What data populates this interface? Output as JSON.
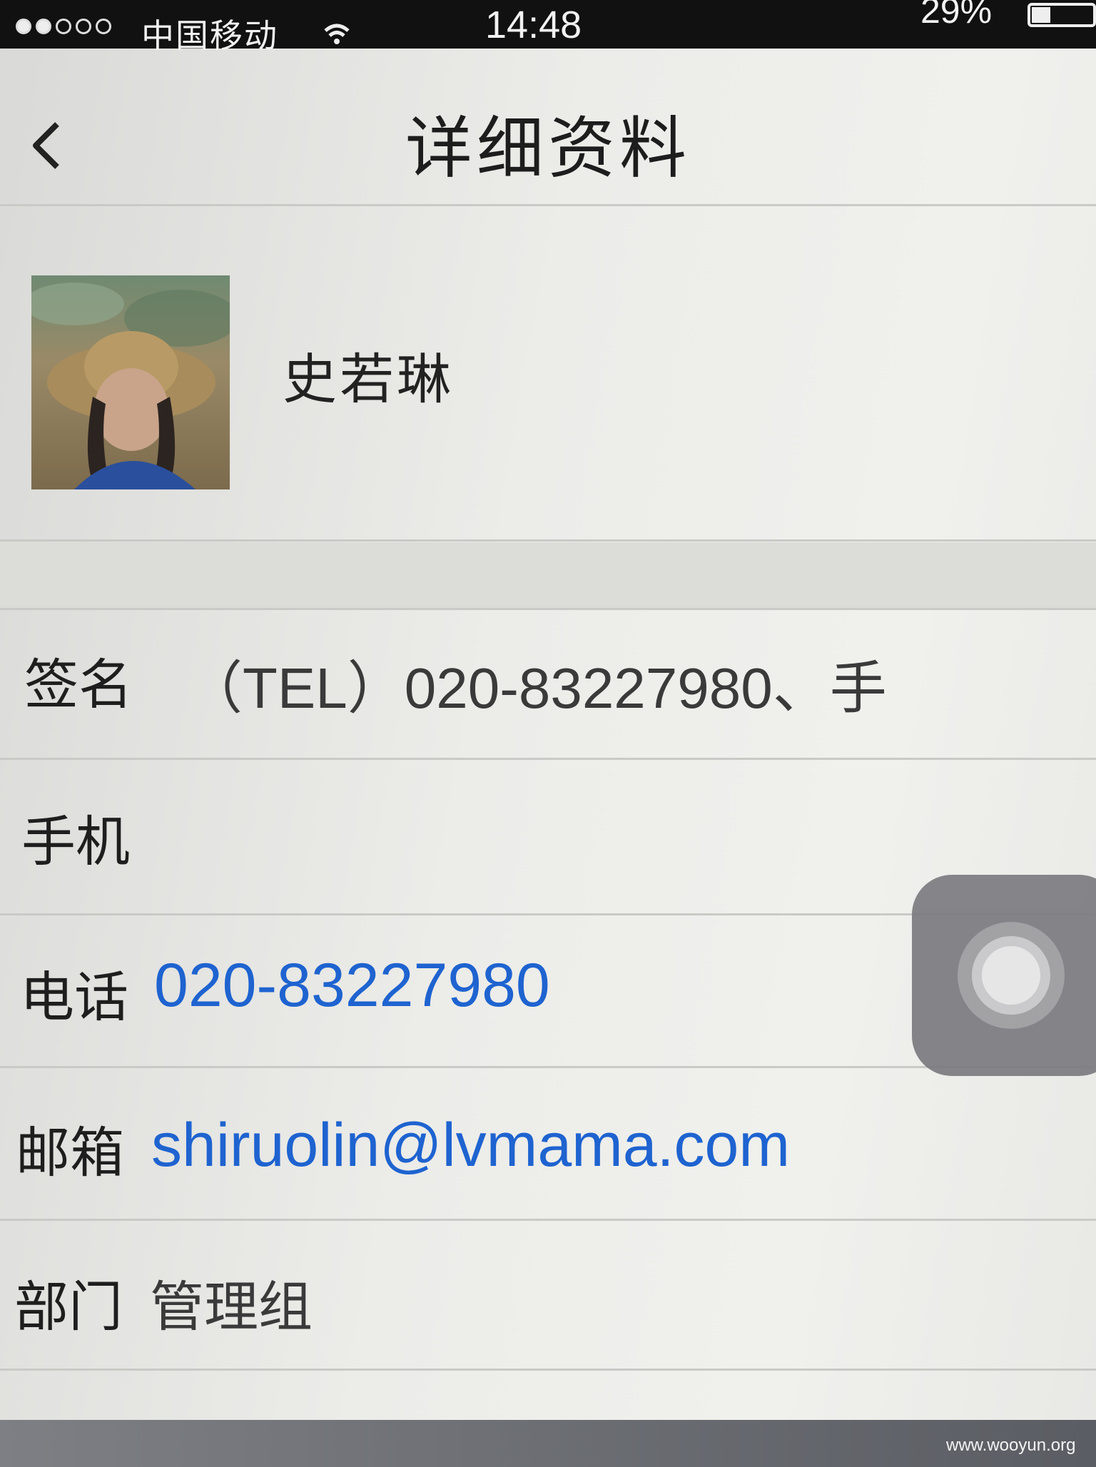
{
  "status_bar": {
    "carrier": "中国移动",
    "time": "14:48",
    "battery_percent": "29%",
    "signal_strength_bars": 2,
    "signal_total_bars": 5
  },
  "nav": {
    "title": "详细资料",
    "back_icon": "chevron-left-icon"
  },
  "profile": {
    "name": "史若琳",
    "avatar": "profile-photo"
  },
  "fields": {
    "signature": {
      "label": "签名",
      "value": "（TEL）020-83227980、手"
    },
    "mobile": {
      "label": "手机",
      "value": ""
    },
    "phone": {
      "label": "电话",
      "value": "020-83227980"
    },
    "email": {
      "label": "邮箱",
      "value": "shiruolin@lvmama.com"
    },
    "department": {
      "label": "部门",
      "value": "管理组"
    }
  },
  "overlay": {
    "assistive_touch": "assistive-touch-button"
  },
  "watermark": "www.wooyun.org",
  "colors": {
    "link": "#1e63d0",
    "status_bar": "#111111"
  }
}
